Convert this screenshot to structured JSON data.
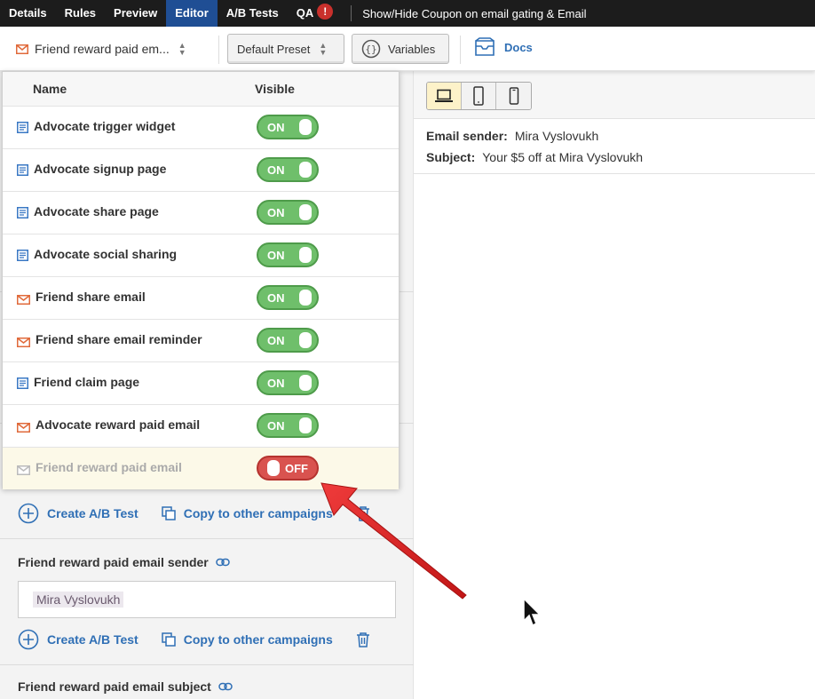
{
  "topnav": {
    "tabs": [
      {
        "label": "Details"
      },
      {
        "label": "Rules"
      },
      {
        "label": "Preview"
      },
      {
        "label": "Editor"
      },
      {
        "label": "A/B Tests"
      },
      {
        "label": "QA"
      }
    ],
    "active_tab": "Editor",
    "qa_badge": "!",
    "breadcrumb": "Show/Hide Coupon on email gating & Email"
  },
  "toolbar": {
    "widget_select": "Friend reward paid em...",
    "preset_select": "Default Preset",
    "variables_label": "Variables",
    "docs_label": "Docs"
  },
  "visibility_panel": {
    "col_name": "Name",
    "col_visible": "Visible",
    "rows": [
      {
        "icon": "page-icon",
        "label": "Advocate trigger widget",
        "state": "ON"
      },
      {
        "icon": "page-icon",
        "label": "Advocate signup page",
        "state": "ON"
      },
      {
        "icon": "page-icon",
        "label": "Advocate share page",
        "state": "ON"
      },
      {
        "icon": "page-icon",
        "label": "Advocate social sharing",
        "state": "ON"
      },
      {
        "icon": "email-icon",
        "label": "Friend share email",
        "state": "ON"
      },
      {
        "icon": "email-icon",
        "label": "Friend share email reminder",
        "state": "ON"
      },
      {
        "icon": "page-icon",
        "label": "Friend claim page",
        "state": "ON"
      },
      {
        "icon": "email-icon",
        "label": "Advocate reward paid email",
        "state": "ON"
      },
      {
        "icon": "email-icon",
        "label": "Friend reward paid email",
        "state": "OFF"
      }
    ]
  },
  "editor": {
    "create_ab_test": "Create A/B Test",
    "copy_to_campaigns": "Copy to other campaigns",
    "sender_label": "Friend reward paid email sender",
    "sender_value": "Mira Vyslovukh",
    "subject_label": "Friend reward paid email subject"
  },
  "preview": {
    "sender_label": "Email sender:",
    "sender_value": "Mira Vyslovukh",
    "subject_label": "Subject:",
    "subject_value": "Your $5 off at Mira Vyslovukh"
  },
  "colors": {
    "active_tab": "#1f4e94",
    "toggle_on": "#6fbf6b",
    "toggle_off": "#d9534f",
    "link": "#2f6fb5",
    "annotation_arrow": "#e02424"
  }
}
